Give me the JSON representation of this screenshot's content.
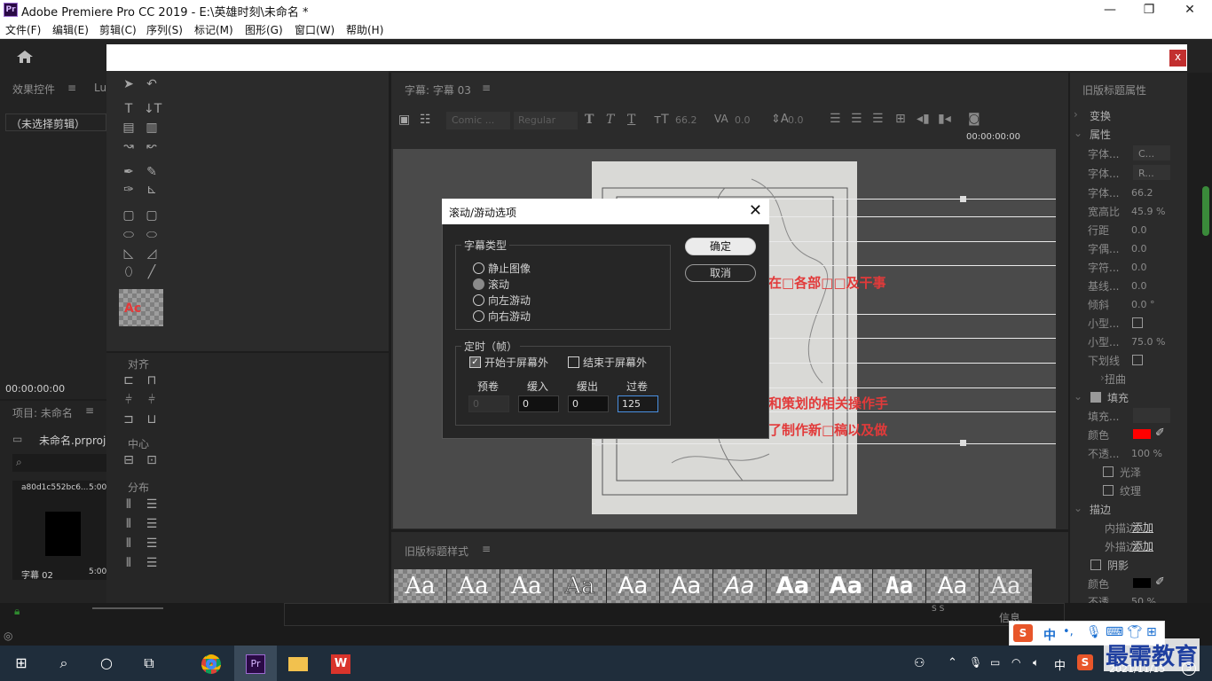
{
  "app": {
    "title": "Adobe Premiere Pro CC 2019 - E:\\英雄时刻\\未命名 *",
    "logo": "Pr",
    "window_controls": [
      "—",
      "❐",
      "✕"
    ]
  },
  "menu": [
    "文件(F)",
    "编辑(E)",
    "剪辑(C)",
    "序列(S)",
    "标记(M)",
    "图形(G)",
    "窗口(W)",
    "帮助(H)"
  ],
  "left_panel": {
    "effects_title": "效果控件",
    "effects_tab2": "Lu",
    "no_clip": "（未选择剪辑）",
    "timecode": "00:00:00:00",
    "project_title": "项目: 未命名",
    "project_file": "未命名.prproj",
    "clip1_name": "a80d1c552bc6...",
    "clip1_duration": "5:00",
    "clip2_name": "字幕 02",
    "clip2_duration": "5:00"
  },
  "tools_panel": {
    "align": "对齐",
    "center": "中心",
    "distribute": "分布",
    "style_preview": "Ac"
  },
  "designer": {
    "tab": "字幕: 字幕 03",
    "font": "Comic ...",
    "style": "Regular",
    "size": "66.2",
    "kerning": "0.0",
    "leading": "0.0",
    "timecode": "00:00:00:00",
    "canvas_text1": "在□各部□□及干事",
    "canvas_text2": "和策划的相关操作手",
    "canvas_text3": "了制作新□稿以及做"
  },
  "styles": {
    "title": "旧版标题样式",
    "samples": [
      "Aa",
      "Aa",
      "Aa",
      "Aa",
      "Aa",
      "Aa",
      "Aa",
      "Aa",
      "Aa",
      "Aa",
      "Aa",
      "Aa"
    ]
  },
  "properties": {
    "title": "旧版标题属性",
    "transform": "变换",
    "attrs": "属性",
    "rows": [
      {
        "label": "字体...",
        "value": "C..."
      },
      {
        "label": "字体...",
        "value": "R..."
      },
      {
        "label": "字体...",
        "value": "66.2"
      },
      {
        "label": "宽高比",
        "value": "45.9 %"
      },
      {
        "label": "行距",
        "value": "0.0"
      },
      {
        "label": "字偶...",
        "value": "0.0"
      },
      {
        "label": "字符...",
        "value": "0.0"
      },
      {
        "label": "基线...",
        "value": "0.0"
      },
      {
        "label": "倾斜",
        "value": "0.0 °"
      },
      {
        "label": "小型...",
        "value": ""
      },
      {
        "label": "小型...",
        "value": "75.0 %"
      },
      {
        "label": "下划线",
        "value": ""
      }
    ],
    "distort": "扭曲",
    "fill": "填充",
    "fill_type": "填充...",
    "color_label": "颜色",
    "opacity_label": "不透...",
    "opacity_value": "100 %",
    "sheen": "光泽",
    "texture": "纹理",
    "stroke": "描边",
    "inner": "内描边",
    "outer": "外描边",
    "add": "添加",
    "shadow": "阴影",
    "shadow_color": "颜色",
    "shadow_opacity": "不透...",
    "shadow_opacity_value": "50 %",
    "fill_color": "#ff0000",
    "shadow_swatch": "#000000"
  },
  "dialog": {
    "title": "滚动/游动选项",
    "type_group": "字幕类型",
    "options": [
      "静止图像",
      "滚动",
      "向左游动",
      "向右游动"
    ],
    "selected": 1,
    "timing_group": "定时（帧）",
    "start_off": "开始于屏幕外",
    "start_off_checked": true,
    "end_off": "结束于屏幕外",
    "end_off_checked": false,
    "fields": [
      {
        "label": "预卷",
        "value": "0"
      },
      {
        "label": "缓入",
        "value": "0"
      },
      {
        "label": "缓出",
        "value": "0"
      },
      {
        "label": "过卷",
        "value": "125"
      }
    ],
    "ok": "确定",
    "cancel": "取消"
  },
  "bottom": {
    "info": "信息"
  },
  "ime": {
    "lang": "中",
    "punct": "•,"
  },
  "taskbar": {
    "lang": "中",
    "date": "2021/11/15",
    "watermark": "最需教育",
    "badge": "3"
  }
}
